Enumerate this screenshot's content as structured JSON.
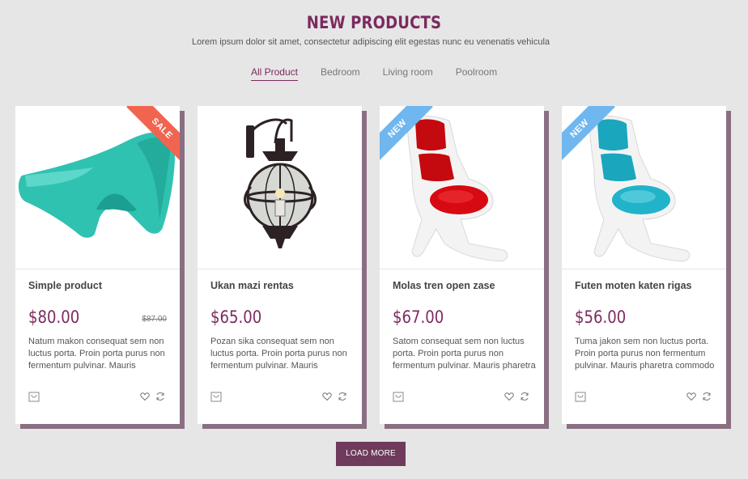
{
  "header": {
    "title": "NEW PRODUCTS",
    "subtitle": "Lorem ipsum dolor sit amet, consectetur adipiscing elit egestas nunc eu venenatis vehicula"
  },
  "tabs": [
    {
      "label": "All Product",
      "active": true
    },
    {
      "label": "Bedroom",
      "active": false
    },
    {
      "label": "Living room",
      "active": false
    },
    {
      "label": "Poolroom",
      "active": false
    }
  ],
  "products": [
    {
      "name": "Simple product",
      "price": "$80.00",
      "old_price": "$87.00",
      "badge": "SALE",
      "description": "Natum makon consequat sem non luctus porta. Proin porta purus non fermentum pulvinar. Mauris",
      "image": "teal-lounge-chair"
    },
    {
      "name": "Ukan mazi rentas",
      "price": "$65.00",
      "old_price": "",
      "badge": "",
      "description": "Pozan sika consequat sem non luctus porta. Proin porta purus non fermentum pulvinar. Mauris",
      "image": "wall-lantern"
    },
    {
      "name": "Molas tren open zase",
      "price": "$67.00",
      "old_price": "",
      "badge": "NEW",
      "description": "Satom consequat sem non luctus porta. Proin porta purus non fermentum pulvinar. Mauris pharetra",
      "image": "red-white-chair"
    },
    {
      "name": "Futen moten katen rigas",
      "price": "$56.00",
      "old_price": "",
      "badge": "NEW",
      "description": "Tuma jakon sem non luctus porta. Proin porta purus non fermentum pulvinar. Mauris pharetra commodo",
      "image": "cyan-white-chair"
    }
  ],
  "load_more_label": "LOAD MORE",
  "colors": {
    "accent": "#7c2a5e",
    "sale": "#f06450",
    "new": "#6fb7ee",
    "button": "#6e3b5c"
  }
}
